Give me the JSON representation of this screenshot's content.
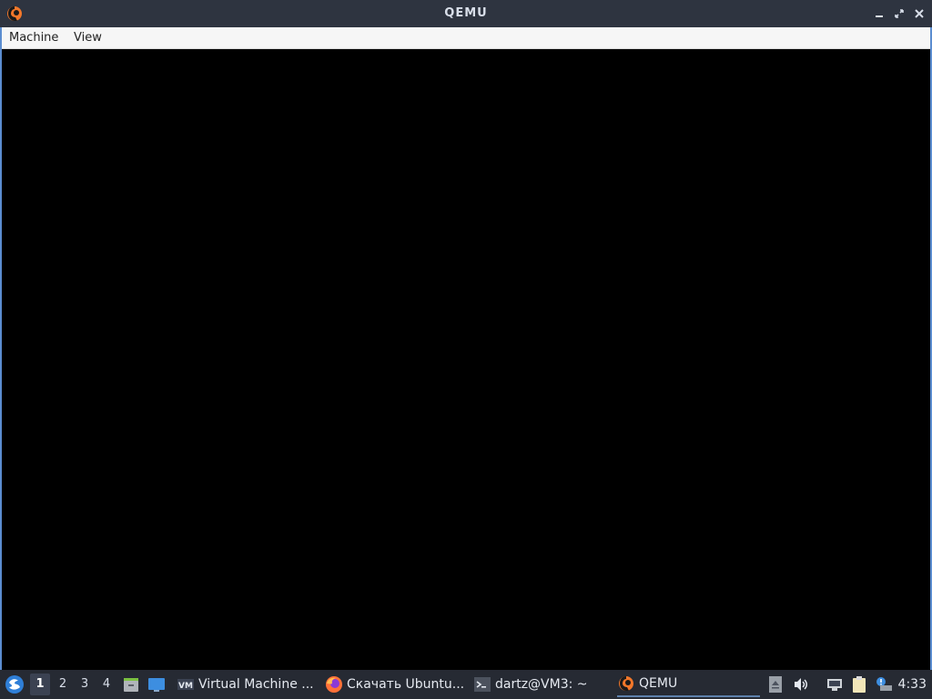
{
  "window": {
    "title": "QEMU",
    "icon": "qemu-logo-icon",
    "controls": [
      "minimize-icon",
      "restore-icon",
      "close-icon"
    ]
  },
  "menubar": {
    "items": [
      {
        "label": "Machine"
      },
      {
        "label": "View"
      }
    ]
  },
  "taskbar": {
    "start_icon": "lxqt-start-icon",
    "workspaces": [
      "1",
      "2",
      "3",
      "4"
    ],
    "active_workspace": "1",
    "quicklaunch": [
      "file-manager-icon",
      "show-desktop-icon"
    ],
    "tasks": [
      {
        "label": "Virtual Machine ...",
        "icon": "virt-manager-icon"
      },
      {
        "label": "Скачать Ubuntu...",
        "icon": "firefox-icon"
      },
      {
        "label": "dartz@VM3: ~",
        "icon": "terminal-icon"
      },
      {
        "label": "QEMU",
        "icon": "qemu-logo-icon",
        "active": true
      }
    ],
    "tray": [
      "volume-up-icon",
      "volume-icon",
      "network-icon",
      "clipboard-icon",
      "notification-icon"
    ],
    "clock": "4:33"
  },
  "colors": {
    "titlebar": "#2e3440",
    "menubar": "#f6f6f6",
    "display": "#000000",
    "taskbar": "#262a33",
    "frame_accent": "#5b8dd0"
  }
}
